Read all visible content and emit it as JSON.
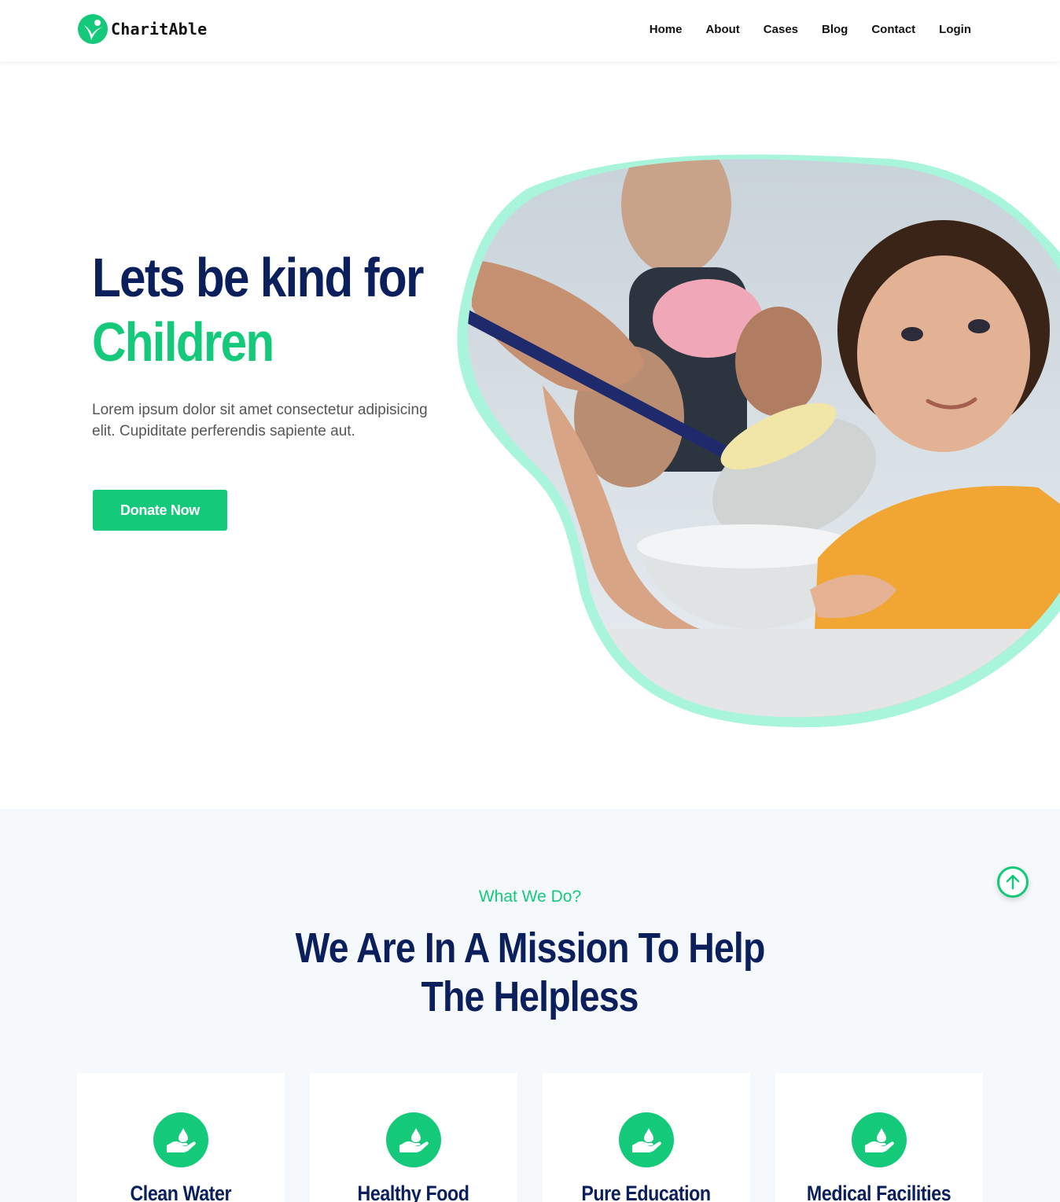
{
  "header": {
    "logo_text": "CharitAble",
    "nav": [
      "Home",
      "About",
      "Cases",
      "Blog",
      "Contact",
      "Login"
    ]
  },
  "hero": {
    "title_line1": "Lets be kind for",
    "title_line2": "Children",
    "text": "Lorem ipsum dolor sit amet consectetur adipisicing elit. Cupiditate perferendis sapiente aut.",
    "donate_label": "Donate Now"
  },
  "what_we_do": {
    "eyebrow": "What We Do?",
    "title_line1": "We Are In A Mission To Help",
    "title_line2": "The Helpless",
    "cards": [
      {
        "title": "Clean Water",
        "icon": "hand-water-drop-icon"
      },
      {
        "title": "Healthy Food",
        "icon": "hand-water-drop-icon"
      },
      {
        "title": "Pure Education",
        "icon": "hand-water-drop-icon"
      },
      {
        "title": "Medical Facilities",
        "icon": "hand-water-drop-icon"
      }
    ]
  },
  "colors": {
    "accent": "#14c97a",
    "navy": "#0b1f5c",
    "blob_outline": "#a8f5dc",
    "section_bg": "#f6f9fc"
  }
}
